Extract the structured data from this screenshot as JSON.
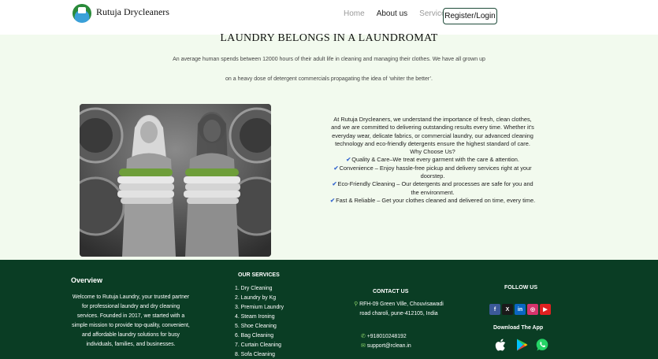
{
  "header": {
    "brand": "Rutuja Drycleaners",
    "nav": [
      {
        "label": "Home",
        "active": false
      },
      {
        "label": "About us",
        "active": true
      },
      {
        "label": "Services",
        "active": false
      }
    ],
    "register_label": "Register/Login"
  },
  "hero": {
    "title": "LAUNDRY BELONGS IN A LAUNDROMAT",
    "subtitle_line1": "An average human spends between 12000 hours of their adult life in cleaning and managing their clothes. We have all grown up",
    "subtitle_line2": "on a heavy dose of detergent commercials propagating the idea of ‘whiter the better’."
  },
  "about": {
    "intro": "At Rutuja Drycleaners, we understand the importance of fresh, clean clothes, and we are committed to delivering outstanding results every time. Whether it's everyday wear, delicate fabrics, or commercial laundry, our advanced cleaning technology and eco-friendly detergents ensure the highest standard of care.",
    "why_heading": "Why Choose Us?",
    "bullets": [
      "Quality & Care–We treat every garment with the care & attention.",
      "Convenience – Enjoy hassle-free pickup and delivery services right at your doorstep.",
      "Eco-Friendly Cleaning – Our detergents and processes are safe for you and the environment.",
      "Fast & Reliable – Get your clothes cleaned and delivered on time, every time."
    ]
  },
  "footer": {
    "overview_title": "Overview",
    "overview_body": "Welcome to Rutuja Laundry, your trusted partner for professional laundry and dry cleaning services. Founded in 2017, we started with a simple mission to provide top-quality, convenient, and affordable laundry solutions for busy individuals, families, and businesses.",
    "services_title": "OUR SERVICES",
    "services": [
      "1. Dry Cleaning",
      "2. Laundry by Kg",
      "3. Premium Laundry",
      "4. Steam Ironing",
      "5. Shoe Cleaning",
      "6. Bag Cleaning",
      "7. Curtain Cleaning",
      "8. Sofa Cleaning"
    ],
    "contact_title": "CONTACT US",
    "address": "RFH-09 Green Ville, Chouvisawadi road charoli, pune-412105, India",
    "phone": "+918010248192",
    "email": "support@rclean.in",
    "follow_title": "FOLLOW US",
    "socials": [
      {
        "icon": "facebook-icon",
        "glyph": "f",
        "color": "#3b5998"
      },
      {
        "icon": "x-icon",
        "glyph": "X",
        "color": "#1a1a1a"
      },
      {
        "icon": "linkedin-icon",
        "glyph": "in",
        "color": "#0a66c2"
      },
      {
        "icon": "instagram-icon",
        "glyph": "◎",
        "color": "#d6336c"
      },
      {
        "icon": "youtube-icon",
        "glyph": "▶",
        "color": "#e02020"
      }
    ],
    "download_title": "Download The App",
    "apps": [
      "apple-icon",
      "google-play-icon",
      "whatsapp-icon"
    ]
  },
  "colors": {
    "footer_bg": "#0a3d24",
    "hero_bg": "#f2faee",
    "accent": "#1f4c3a"
  }
}
